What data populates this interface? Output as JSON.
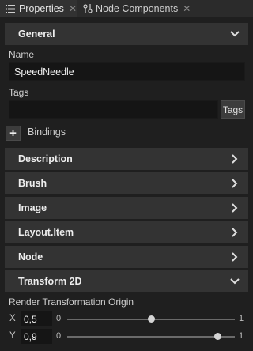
{
  "tabs": [
    {
      "label": "Properties",
      "icon": "list-icon",
      "active": true
    },
    {
      "label": "Node Components",
      "icon": "components-icon",
      "active": false
    }
  ],
  "sections": {
    "general": "General",
    "description": "Description",
    "brush": "Brush",
    "image": "Image",
    "layout_item": "Layout.Item",
    "node": "Node",
    "transform2d": "Transform 2D"
  },
  "fields": {
    "name_label": "Name",
    "name_value": "SpeedNeedle",
    "tags_label": "Tags",
    "tags_value": "",
    "tags_button": "Tags"
  },
  "bindings": {
    "plus": "+",
    "label": "Bindings"
  },
  "transform": {
    "origin_label": "Render Transformation Origin",
    "x": {
      "axis": "X",
      "value": "0,5",
      "min": "0",
      "max": "1",
      "fraction": 0.5
    },
    "y": {
      "axis": "Y",
      "value": "0,9",
      "min": "0",
      "max": "1",
      "fraction": 0.9
    }
  },
  "colors": {
    "background": "#1f1f1f",
    "section": "#333333",
    "field": "#151515"
  }
}
